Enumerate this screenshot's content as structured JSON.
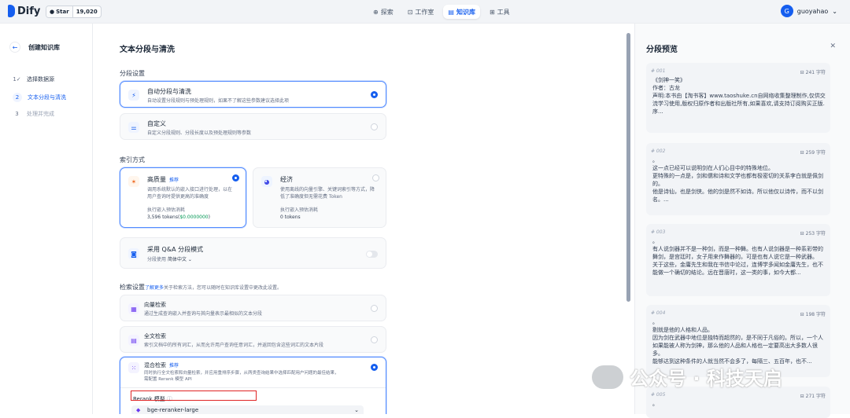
{
  "app": {
    "name": "Dify",
    "star_label": "Star",
    "star_count": "19,020"
  },
  "nav": [
    {
      "label": "探索",
      "icon": "compass-icon"
    },
    {
      "label": "工作室",
      "icon": "studio-icon"
    },
    {
      "label": "知识库",
      "icon": "book-icon"
    },
    {
      "label": "工具",
      "icon": "tool-icon"
    }
  ],
  "user": {
    "initial": "G",
    "name": "guoyahao"
  },
  "sidebar": {
    "title": "创建知识库",
    "steps": [
      {
        "num": "1",
        "label": "选择数据源"
      },
      {
        "num": "2",
        "label": "文本分段与清洗"
      },
      {
        "num": "3",
        "label": "处理并完成"
      }
    ]
  },
  "main": {
    "title": "文本分段与清洗",
    "segmentation_label": "分段设置",
    "auto": {
      "title": "自动分段与清洗",
      "desc": "自动设置分段规则与预处理规则，如果不了解这些参数建议选择此项"
    },
    "custom": {
      "title": "自定义",
      "desc": "自定义分段规则、分段长度以及预处理规则等参数"
    },
    "index_label": "索引方式",
    "high": {
      "title": "高质量",
      "badge": "推荐",
      "desc": "调用系统默认的嵌入接口进行处理，以在用户查询时提供更高的准确度",
      "cost_label": "执行嵌入预估消耗",
      "cost_tokens": "3,596 tokens(",
      "cost_money": "$0.0000000",
      "cost_end": ")"
    },
    "eco": {
      "title": "经济",
      "desc": "使用离线的向量引擎、关键词索引等方式，降低了准确度但无需花费 Token",
      "cost_label": "执行嵌入预估消耗",
      "cost_tokens": "0 tokens"
    },
    "qa": {
      "title": "采用 Q&A 分段模式",
      "sub": "分段使用",
      "lang": "简体中文"
    },
    "retrieval_label": "检索设置",
    "retrieval_link": "了解更多",
    "retrieval_desc": "关于检索方法，您可以随时在知识库设置中更改此设置。",
    "vector": {
      "title": "向量检索",
      "desc": "通过生成查询嵌入并查询与其向量表示最相似的文本分段"
    },
    "fulltext": {
      "title": "全文检索",
      "desc": "索引文档中的所有词汇，从而允许用户查询任意词汇，并返回包含这些词汇的文本片段"
    },
    "hybrid": {
      "title": "混合检索",
      "badge": "推荐",
      "desc1": "同时执行全文检索和向量检索，并应用重排序步骤，从两类查询结果中选择匹配用户问题的最佳结果，",
      "desc2": "需配置 Rerank 模型 API"
    },
    "rerank_label": "Rerank 模型",
    "rerank_model": "bge-reranker-large"
  },
  "preview": {
    "title": "分段预览",
    "segments": [
      {
        "id": "# 001",
        "count": "241 字符",
        "text": "《剑神一笑》\n作者：古龙\n声明:本书由【淘书客】www.taoshuke.cn自网络收集整理制作,仅供交流学习使用,版权归原作者和出版社所有,如果喜欢,请支持订阅购买正版.\n序..."
      },
      {
        "id": "# 002",
        "count": "259 字符",
        "text": "。\n这一点已经可以说明剑在人们心目中的特殊地位。\n更特殊的一点是，剑和儒和诗和文学也都有极密切的关系李白就是佩剑的。\n他是诗仙，也是剑侠。他的剑是然不如诗。所以他仅以诗传，而不以剑名。..."
      },
      {
        "id": "# 003",
        "count": "253 字符",
        "text": "。\n有人说剑器并不是一种剑，而是一种舞。也有人说剑器是一种系彩带的舞剑，是宫廷时，女子用来作舞器的。可是也有人说它是一种武器。\n关于这些，金庸先生和我在书信中论过，连博学多闻如金庸先生，也不能做一个确切的结论。远在晋唐时，这一类的事，如今大都..."
      },
      {
        "id": "# 004",
        "count": "198 字符",
        "text": "。\n剔就是他的人格和人品。\n因为剑在武器中地位是独特而超然的，是不同于凡俗的。所以，一个人如果能被人称为剑神，那么他的人品和人格也一定要高出大多数人很多。\n能够达到这种条件的人就当然不会多了，每隔三、五百年，也不..."
      },
      {
        "id": "# 005",
        "count": "271 字符",
        "text": "。"
      }
    ]
  },
  "watermark": "公众号 · 科技天启",
  "colors": {
    "accent": "#155eef",
    "highlight_box": "#e02424"
  }
}
